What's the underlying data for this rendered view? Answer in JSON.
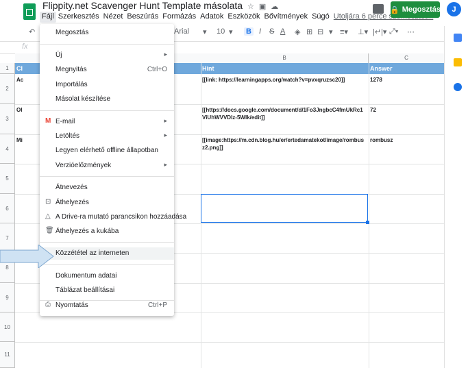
{
  "header": {
    "doc_title": "Flippity.net Scavenger Hunt Template másolata",
    "share_label": "Megosztás",
    "avatar_letter": "J",
    "menus": [
      "Fájl",
      "Szerkesztés",
      "Nézet",
      "Beszúrás",
      "Formázás",
      "Adatok",
      "Eszközök",
      "Bővítmények",
      "Súgó"
    ],
    "last_edit": "Utoljára 6 perce szerkesztet..."
  },
  "toolbar": {
    "font": "Arial",
    "size": "10",
    "bold": "B",
    "italic": "I",
    "strike": "S",
    "text_color": "A"
  },
  "formula_bar": {
    "fx": "fx"
  },
  "grid": {
    "col_headers": [
      "B",
      "C"
    ],
    "row_numbers": [
      "1",
      "2",
      "3",
      "4",
      "5",
      "6",
      "7",
      "8",
      "9",
      "10",
      "11"
    ],
    "header_cells": {
      "a": "Cl",
      "b": "Hint",
      "c": "Answer"
    },
    "rows": [
      {
        "a": "Ac",
        "b": "[[link: https://learningapps.org/watch?v=pvxqruzsc20]]",
        "c": "1278"
      },
      {
        "a": "Ol",
        "b": "[[https://docs.google.com/document/d/1Fo3JngbcC4fmUkRc1ViUhWVVDlz-5WIk/edit]]",
        "c": "72"
      },
      {
        "a": "Mi",
        "b": "[[image:https://m.cdn.blog.hu/er/ertedamatekot/image/rombusz2.png]]",
        "c": "rombusz"
      }
    ]
  },
  "file_menu": {
    "items": [
      {
        "label": "Megosztás",
        "icon": "",
        "shortcut": "",
        "submenu": false
      },
      {
        "label": "Új",
        "icon": "",
        "shortcut": "",
        "submenu": true
      },
      {
        "label": "Megnyitás",
        "icon": "",
        "shortcut": "Ctrl+O",
        "submenu": false
      },
      {
        "label": "Importálás",
        "icon": "",
        "shortcut": "",
        "submenu": false
      },
      {
        "label": "Másolat készítése",
        "icon": "",
        "shortcut": "",
        "submenu": false
      },
      {
        "label": "E-mail",
        "icon": "gmail-icon",
        "shortcut": "",
        "submenu": true
      },
      {
        "label": "Letöltés",
        "icon": "",
        "shortcut": "",
        "submenu": true
      },
      {
        "label": "Legyen elérhető offline állapotban",
        "icon": "",
        "shortcut": "",
        "submenu": false
      },
      {
        "label": "Verzióelőzmények",
        "icon": "",
        "shortcut": "",
        "submenu": true
      },
      {
        "label": "Átnevezés",
        "icon": "",
        "shortcut": "",
        "submenu": false
      },
      {
        "label": "Áthelyezés",
        "icon": "folder-move-icon",
        "shortcut": "",
        "submenu": false
      },
      {
        "label": "A Drive-ra mutató parancsikon hozzáadása",
        "icon": "drive-shortcut-icon",
        "shortcut": "",
        "submenu": false
      },
      {
        "label": "Áthelyezés a kukába",
        "icon": "trash-icon",
        "shortcut": "",
        "submenu": false
      },
      {
        "label": "Közzététel az interneten",
        "icon": "",
        "shortcut": "",
        "submenu": false
      },
      {
        "label": "Dokumentum adatai",
        "icon": "",
        "shortcut": "",
        "submenu": false
      },
      {
        "label": "Táblázat beállításai",
        "icon": "",
        "shortcut": "",
        "submenu": false
      },
      {
        "label": "Nyomtatás",
        "icon": "print-icon",
        "shortcut": "Ctrl+P",
        "submenu": false
      }
    ]
  },
  "colors": {
    "header_row": "#6fa8dc",
    "share_green": "#1e8e3e",
    "selection_blue": "#1a73e8",
    "arrow_fill": "#cfe2f3"
  }
}
